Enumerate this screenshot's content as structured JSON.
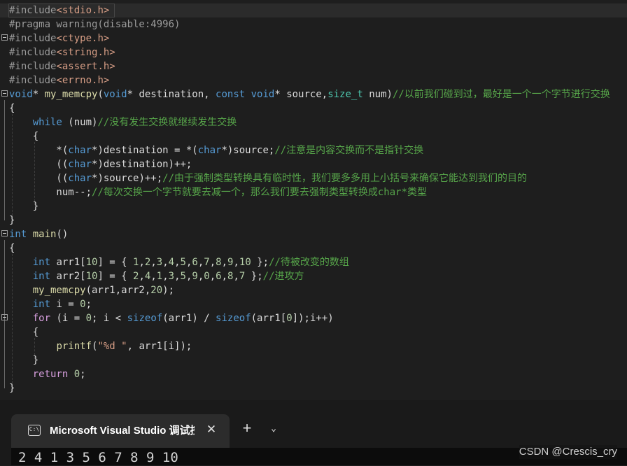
{
  "editor": {
    "lines": [
      [
        [
          "#include",
          "pp"
        ],
        [
          "<stdio.h>",
          "inc"
        ]
      ],
      [
        [
          "#pragma warning(disable:4996)",
          "pp"
        ]
      ],
      [
        [
          "#include",
          "pp"
        ],
        [
          "<ctype.h>",
          "inc"
        ]
      ],
      [
        [
          "#include",
          "pp"
        ],
        [
          "<string.h>",
          "inc"
        ]
      ],
      [
        [
          "#include",
          "pp"
        ],
        [
          "<assert.h>",
          "inc"
        ]
      ],
      [
        [
          "#include",
          "pp"
        ],
        [
          "<errno.h>",
          "inc"
        ]
      ],
      [
        [
          "void",
          "kw"
        ],
        [
          "* ",
          "var"
        ],
        [
          "my_memcpy",
          "fn"
        ],
        [
          "(",
          "var"
        ],
        [
          "void",
          "kw"
        ],
        [
          "* destination, ",
          "var"
        ],
        [
          "const",
          "kw"
        ],
        [
          " ",
          "var"
        ],
        [
          "void",
          "kw"
        ],
        [
          "* source,",
          "var"
        ],
        [
          "size_t",
          "ty"
        ],
        [
          " num)",
          "var"
        ],
        [
          "//以前我们碰到过，最好是一个一个字节进行交换",
          "cm"
        ]
      ],
      [
        [
          "{",
          "var"
        ]
      ],
      [
        [
          "    ",
          "var"
        ],
        [
          "while",
          "kw"
        ],
        [
          " (num)",
          "var"
        ],
        [
          "//没有发生交换就继续发生交换",
          "cm"
        ]
      ],
      [
        [
          "    {",
          "var"
        ]
      ],
      [
        [
          "        *(",
          "var"
        ],
        [
          "char",
          "kw"
        ],
        [
          "*)destination = *(",
          "var"
        ],
        [
          "char",
          "kw"
        ],
        [
          "*)source;",
          "var"
        ],
        [
          "//注意是内容交换而不是指针交换",
          "cm"
        ]
      ],
      [
        [
          "        ((",
          "var"
        ],
        [
          "char",
          "kw"
        ],
        [
          "*)destination)++;",
          "var"
        ]
      ],
      [
        [
          "        ((",
          "var"
        ],
        [
          "char",
          "kw"
        ],
        [
          "*)source)++;",
          "var"
        ],
        [
          "//由于强制类型转换具有临时性，我们要多多用上小括号来确保它能达到我们的目的",
          "cm"
        ]
      ],
      [
        [
          "        num--;",
          "var"
        ],
        [
          "//每次交换一个字节就要去减一个，那么我们要去强制类型转换成char*类型",
          "cm"
        ]
      ],
      [
        [
          "    }",
          "var"
        ]
      ],
      [
        [
          "}",
          "var"
        ]
      ],
      [
        [
          "int",
          "kw"
        ],
        [
          " ",
          "var"
        ],
        [
          "main",
          "fn"
        ],
        [
          "()",
          "var"
        ]
      ],
      [
        [
          "{",
          "var"
        ]
      ],
      [
        [
          "    ",
          "var"
        ],
        [
          "int",
          "kw"
        ],
        [
          " arr1[",
          "var"
        ],
        [
          "10",
          "num"
        ],
        [
          "] = { ",
          "var"
        ],
        [
          "1",
          "num"
        ],
        [
          ",",
          "var"
        ],
        [
          "2",
          "num"
        ],
        [
          ",",
          "var"
        ],
        [
          "3",
          "num"
        ],
        [
          ",",
          "var"
        ],
        [
          "4",
          "num"
        ],
        [
          ",",
          "var"
        ],
        [
          "5",
          "num"
        ],
        [
          ",",
          "var"
        ],
        [
          "6",
          "num"
        ],
        [
          ",",
          "var"
        ],
        [
          "7",
          "num"
        ],
        [
          ",",
          "var"
        ],
        [
          "8",
          "num"
        ],
        [
          ",",
          "var"
        ],
        [
          "9",
          "num"
        ],
        [
          ",",
          "var"
        ],
        [
          "10",
          "num"
        ],
        [
          " };",
          "var"
        ],
        [
          "//待被改变的数组",
          "cm"
        ]
      ],
      [
        [
          "    ",
          "var"
        ],
        [
          "int",
          "kw"
        ],
        [
          " arr2[",
          "var"
        ],
        [
          "10",
          "num"
        ],
        [
          "] = { ",
          "var"
        ],
        [
          "2",
          "num"
        ],
        [
          ",",
          "var"
        ],
        [
          "4",
          "num"
        ],
        [
          ",",
          "var"
        ],
        [
          "1",
          "num"
        ],
        [
          ",",
          "var"
        ],
        [
          "3",
          "num"
        ],
        [
          ",",
          "var"
        ],
        [
          "5",
          "num"
        ],
        [
          ",",
          "var"
        ],
        [
          "9",
          "num"
        ],
        [
          ",",
          "var"
        ],
        [
          "0",
          "num"
        ],
        [
          ",",
          "var"
        ],
        [
          "6",
          "num"
        ],
        [
          ",",
          "var"
        ],
        [
          "8",
          "num"
        ],
        [
          ",",
          "var"
        ],
        [
          "7",
          "num"
        ],
        [
          " };",
          "var"
        ],
        [
          "//进攻方",
          "cm"
        ]
      ],
      [
        [
          "    ",
          "var"
        ],
        [
          "my_memcpy",
          "fn"
        ],
        [
          "(arr1,arr2,",
          "var"
        ],
        [
          "20",
          "num"
        ],
        [
          ");",
          "var"
        ]
      ],
      [
        [
          "    ",
          "var"
        ],
        [
          "int",
          "kw"
        ],
        [
          " i = ",
          "var"
        ],
        [
          "0",
          "num"
        ],
        [
          ";",
          "var"
        ]
      ],
      [
        [
          "    ",
          "var"
        ],
        [
          "for",
          "ctl"
        ],
        [
          " (i = ",
          "var"
        ],
        [
          "0",
          "num"
        ],
        [
          "; i < ",
          "var"
        ],
        [
          "sizeof",
          "kw"
        ],
        [
          "(arr1) / ",
          "var"
        ],
        [
          "sizeof",
          "kw"
        ],
        [
          "(arr1[",
          "var"
        ],
        [
          "0",
          "num"
        ],
        [
          "]);i++)",
          "var"
        ]
      ],
      [
        [
          "    {",
          "var"
        ]
      ],
      [
        [
          "        ",
          "var"
        ],
        [
          "printf",
          "fn"
        ],
        [
          "(",
          "var"
        ],
        [
          "\"%d \"",
          "str"
        ],
        [
          ", arr1[i]);",
          "var"
        ]
      ],
      [
        [
          "    }",
          "var"
        ]
      ],
      [
        [
          "    ",
          "var"
        ],
        [
          "return",
          "ctl"
        ],
        [
          " ",
          "var"
        ],
        [
          "0",
          "num"
        ],
        [
          ";",
          "var"
        ]
      ],
      [
        [
          "}",
          "var"
        ]
      ]
    ]
  },
  "taskbar": {
    "terminal_icon": "C:\\",
    "tab_title": "Microsoft Visual Studio 调试控制台",
    "close_glyph": "✕",
    "new_tab_glyph": "+",
    "dropdown_glyph": "⌄",
    "output": "2 4 1 3 5 6 7 8 9 10"
  },
  "watermark": "CSDN @Crescis_cry"
}
